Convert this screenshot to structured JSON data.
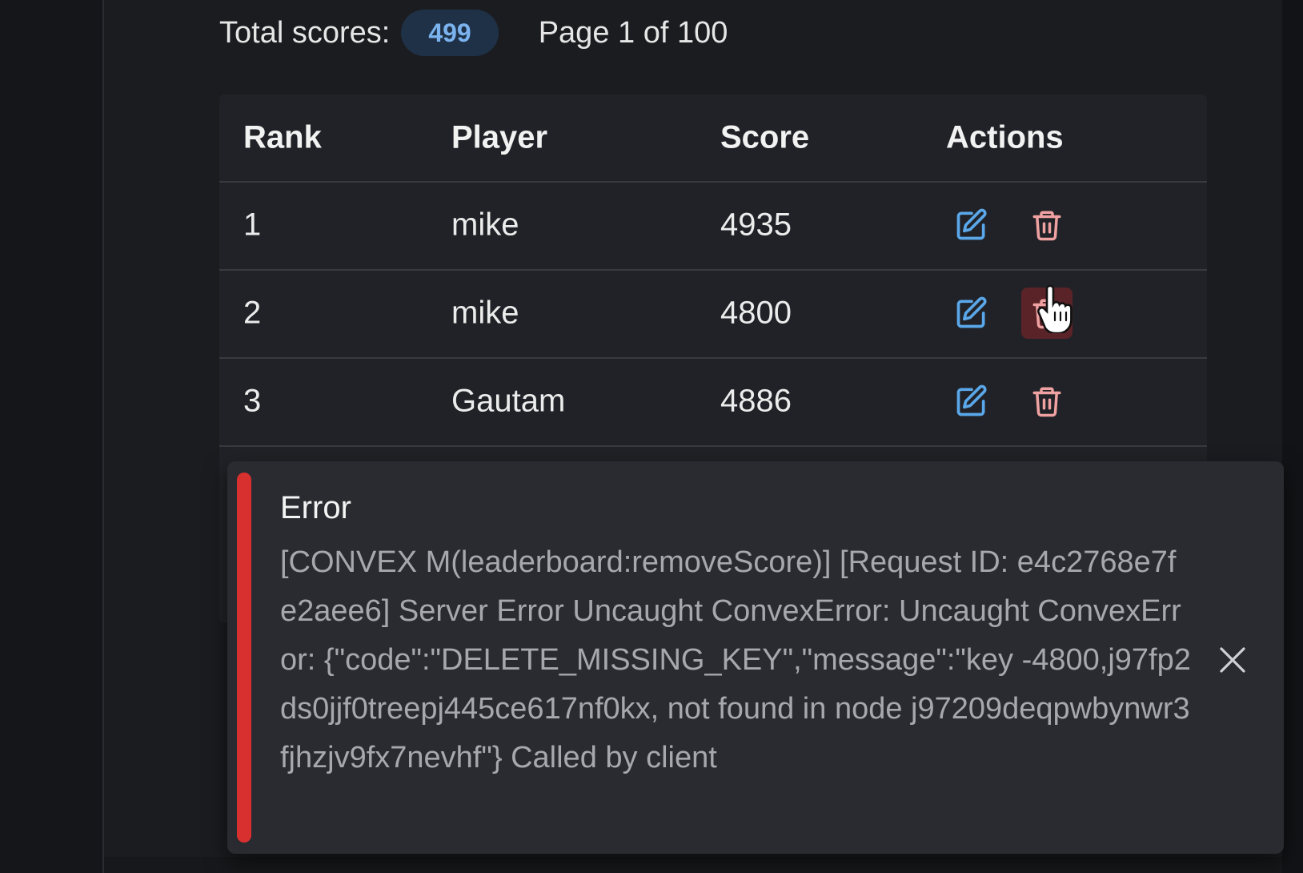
{
  "summary": {
    "total_label": "Total scores:",
    "total_count": "499",
    "page_info": "Page 1 of 100"
  },
  "table": {
    "headers": [
      "Rank",
      "Player",
      "Score",
      "Actions"
    ],
    "rows": [
      {
        "rank": "1",
        "player": "mike",
        "score": "4935"
      },
      {
        "rank": "2",
        "player": "mike",
        "score": "4800"
      },
      {
        "rank": "3",
        "player": "Gautam",
        "score": "4886"
      }
    ],
    "actions": {
      "edit_icon": "edit-icon",
      "delete_icon": "trash-icon"
    }
  },
  "toast": {
    "title": "Error",
    "message": "[CONVEX M(leaderboard:removeScore)] [Request ID: e4c2768e7fe2aee6] Server Error Uncaught ConvexError: Uncaught ConvexError: {\"code\":\"DELETE_MISSING_KEY\",\"message\":\"key -4800,j97fp2ds0jjf0treepj445ce617nf0kx, not found in node j97209deqpwbynwr3fjhzjv9fx7nevhf\"} Called by client",
    "close_icon": "close-icon"
  },
  "colors": {
    "badge_text": "#7bb3ee",
    "edit_icon": "#5aa8ea",
    "delete_icon": "#f0a2a2",
    "error_bar": "#d8302f"
  }
}
